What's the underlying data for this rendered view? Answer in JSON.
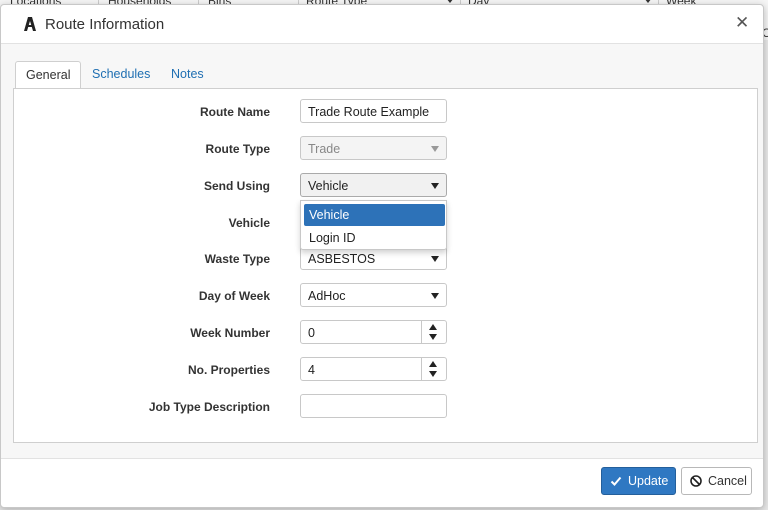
{
  "background": {
    "columns": [
      "Locations",
      "Households",
      "Bins",
      "Route Type",
      "Day",
      "Week"
    ],
    "right_text": "C"
  },
  "dialog": {
    "title": "Route Information",
    "close_icon": "close-icon",
    "logo_icon": "logo-icon"
  },
  "tabs": [
    "General",
    "Schedules",
    "Notes"
  ],
  "active_tab": "General",
  "form": {
    "route_name": {
      "label": "Route Name",
      "value": "Trade Route Example"
    },
    "route_type": {
      "label": "Route Type",
      "value": "Trade"
    },
    "send_using": {
      "label": "Send Using",
      "value": "Vehicle"
    },
    "vehicle": {
      "label": "Vehicle",
      "value": ""
    },
    "waste_type": {
      "label": "Waste Type",
      "value": "ASBESTOS"
    },
    "day_of_week": {
      "label": "Day of Week",
      "value": "AdHoc"
    },
    "week_number": {
      "label": "Week Number",
      "value": "0"
    },
    "no_properties": {
      "label": "No. Properties",
      "value": "4"
    },
    "job_type_description": {
      "label": "Job Type Description",
      "value": ""
    }
  },
  "send_using_dropdown": {
    "options": [
      "Vehicle",
      "Login ID"
    ],
    "selected": "Vehicle"
  },
  "footer": {
    "update_label": "Update",
    "cancel_label": "Cancel"
  },
  "colors": {
    "primary": "#2f78c2",
    "selected_option": "#2d72b8",
    "link": "#1f6fb2"
  }
}
